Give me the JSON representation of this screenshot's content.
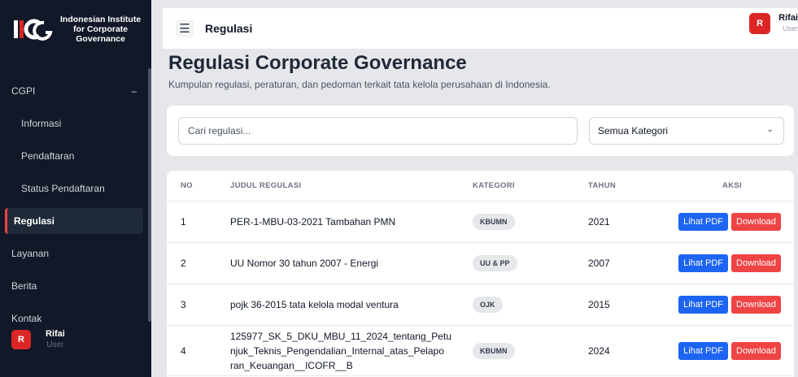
{
  "brand": {
    "logo_text": "IICG",
    "name_line1": "Indonesian Institute",
    "name_line2": "for Corporate",
    "name_line3": "Governance"
  },
  "sidebar": {
    "group": {
      "label": "CGPI",
      "toggle": "–"
    },
    "sub_items": [
      {
        "label": "Informasi"
      },
      {
        "label": "Pendaftaran"
      },
      {
        "label": "Status Pendaftaran"
      }
    ],
    "items": [
      {
        "label": "Regulasi"
      },
      {
        "label": "Layanan"
      },
      {
        "label": "Berita"
      },
      {
        "label": "Kontak"
      }
    ],
    "user": {
      "initial": "R",
      "name": "Rifai",
      "role": "User"
    }
  },
  "header": {
    "menu_icon": "☰",
    "title": "Regulasi",
    "user": {
      "initial": "R",
      "name": "Rifai",
      "role": "User"
    }
  },
  "page": {
    "title": "Regulasi Corporate Governance",
    "subtitle": "Kumpulan regulasi, peraturan, dan pedoman terkait tata kelola perusahaan di Indonesia."
  },
  "filters": {
    "search_placeholder": "Cari regulasi...",
    "category_selected": "Semua Kategori"
  },
  "table": {
    "headers": {
      "no": "NO",
      "title": "JUDUL REGULASI",
      "category": "KATEGORI",
      "year": "TAHUN",
      "action": "AKSI"
    },
    "rows": [
      {
        "no": "1",
        "title": "PER-1-MBU-03-2021 Tambahan PMN",
        "category": "KBUMN",
        "year": "2021"
      },
      {
        "no": "2",
        "title": "UU Nomor 30 tahun 2007 - Energi",
        "category": "UU & PP",
        "year": "2007"
      },
      {
        "no": "3",
        "title": "pojk 36-2015 tata kelola modal ventura",
        "category": "OJK",
        "year": "2015"
      },
      {
        "no": "4",
        "title_l1": "125977_SK_5_DKU_MBU_11_2024_tentang_Petu",
        "title_l2": "njuk_Teknis_Pengendalian_Internal_atas_Pelapo",
        "title_l3": "ran_Keuangan__ICOFR__B",
        "category": "KBUMN",
        "year": "2024"
      }
    ],
    "actions": {
      "view": "Lihat PDF",
      "download": "Download"
    }
  },
  "colors": {
    "sidebar_bg": "#111827",
    "accent_red": "#dc2626",
    "button_blue": "#1d64f2",
    "button_red": "#ef4444"
  }
}
